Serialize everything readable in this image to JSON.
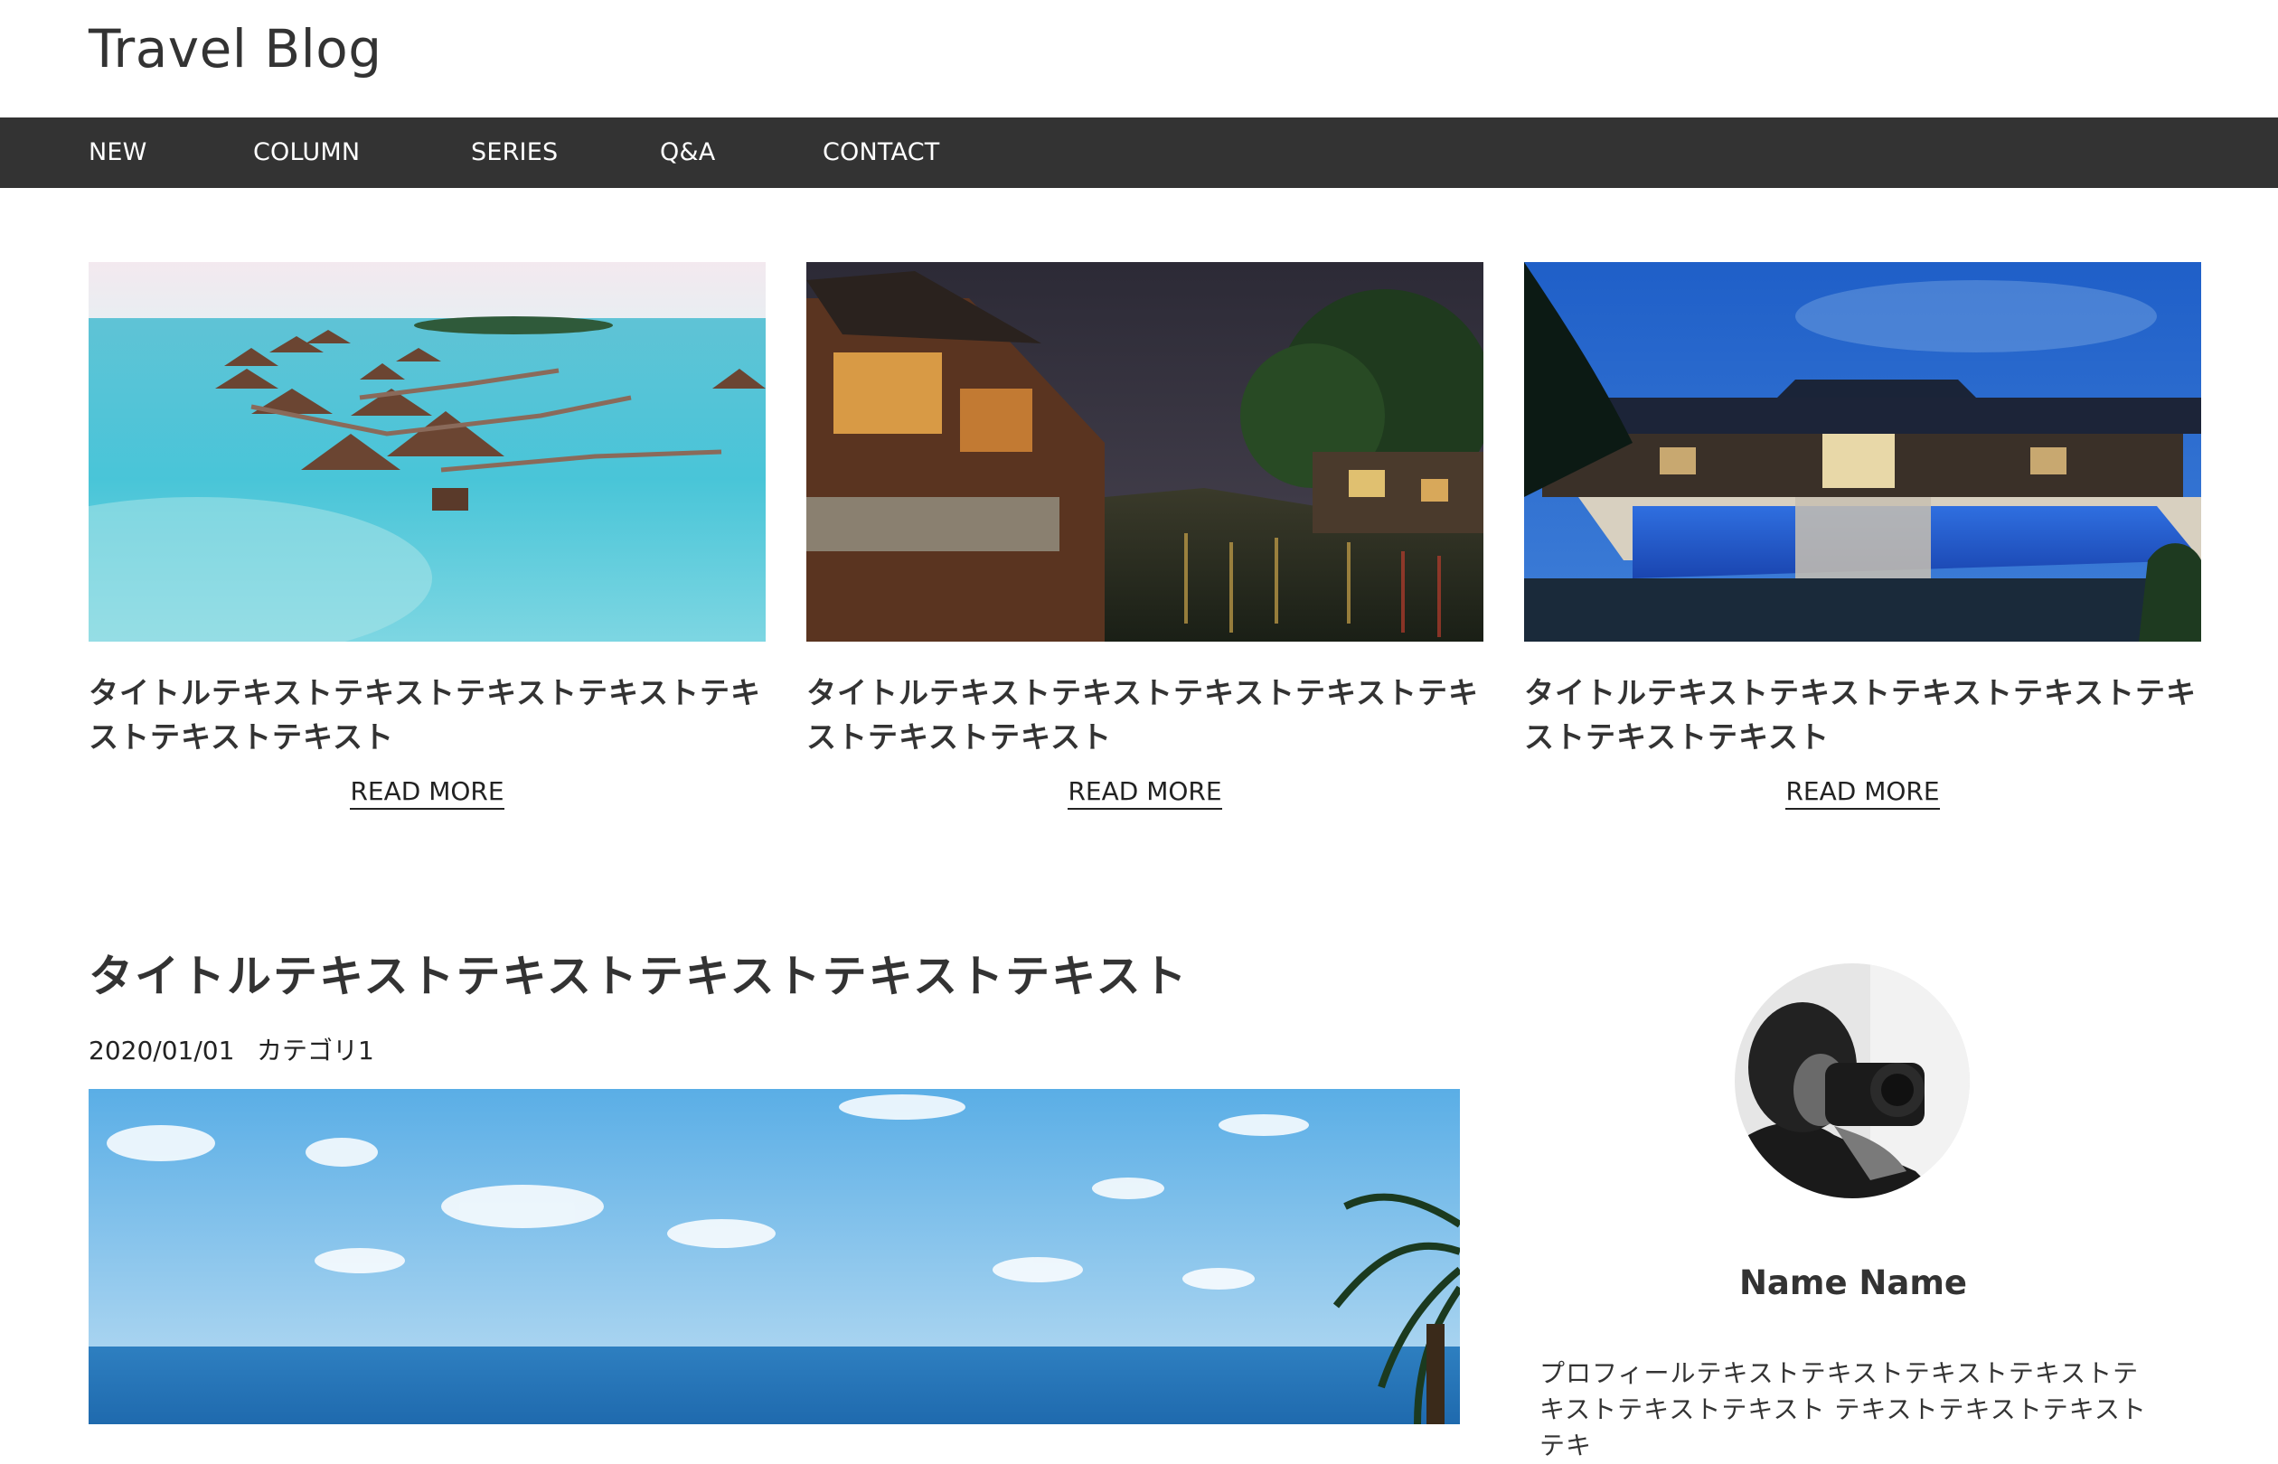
{
  "site": {
    "title": "Travel Blog"
  },
  "nav": {
    "items": [
      "NEW",
      "COLUMN",
      "SERIES",
      "Q&A",
      "CONTACT"
    ]
  },
  "cards": [
    {
      "title": "タイトルテキストテキストテキストテキストテキストテキストテキスト",
      "read_more": "READ MORE",
      "image": "overwater-bungalows-photo"
    },
    {
      "title": "タイトルテキストテキストテキストテキストテキストテキストテキスト",
      "read_more": "READ MORE",
      "image": "night-canal-town-photo"
    },
    {
      "title": "タイトルテキストテキストテキストテキストテキストテキストテキスト",
      "read_more": "READ MORE",
      "image": "resort-pool-dusk-photo"
    }
  ],
  "article": {
    "title": "タイトルテキストテキストテキストテキストテキスト",
    "date": "2020/01/01",
    "category": "カテゴリ1",
    "image": "ocean-palm-sky-photo"
  },
  "profile": {
    "name": "Name Name",
    "text": "プロフィールテキストテキストテキストテキストテキストテキストテキスト テキストテキストテキストテキ",
    "avatar": "photographer-avatar"
  },
  "colors": {
    "nav_background": "#333333",
    "nav_text": "#ffffff",
    "text": "#333333"
  }
}
